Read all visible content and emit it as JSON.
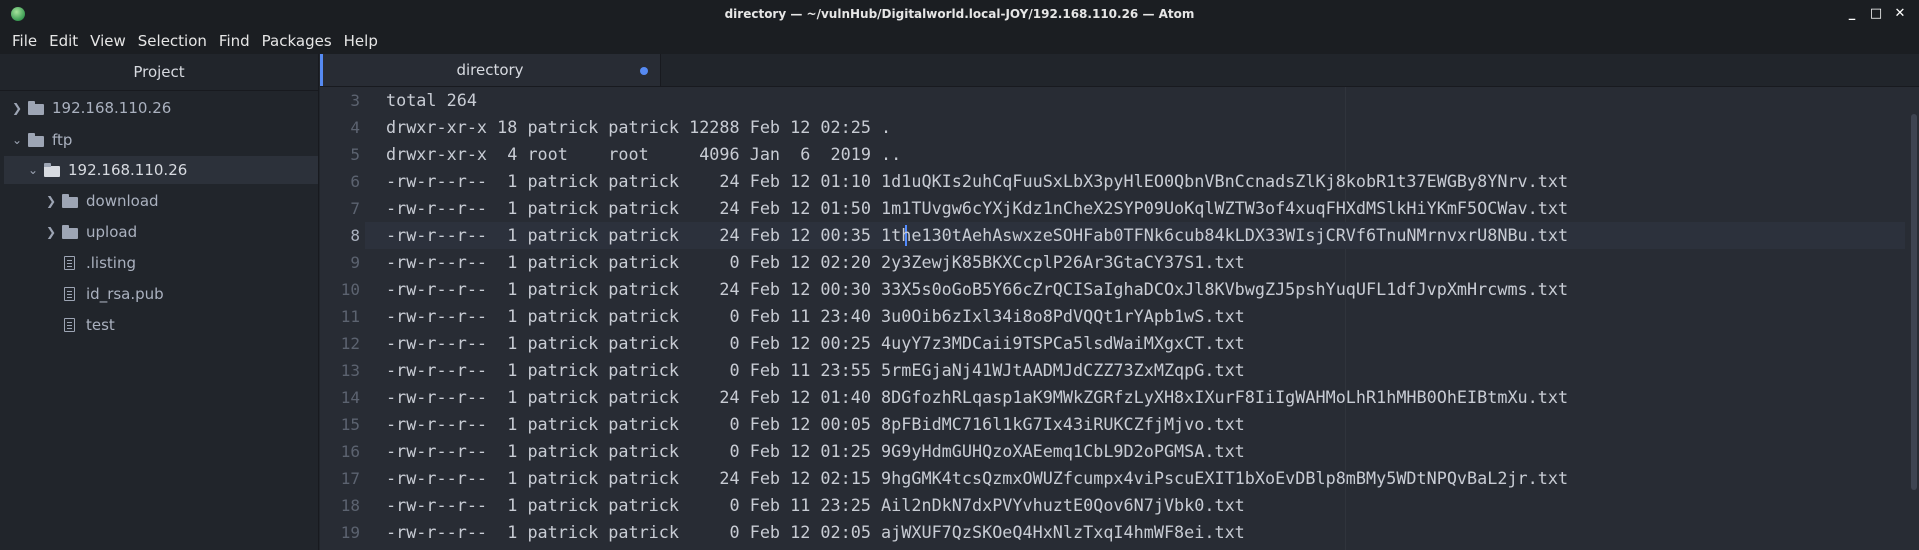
{
  "window": {
    "title": "directory — ~/vulnHub/Digitalworld.local-JOY/192.168.110.26 — Atom",
    "controls": [
      "_",
      "□",
      "✕"
    ]
  },
  "menu": [
    {
      "label": "File"
    },
    {
      "label": "Edit"
    },
    {
      "label": "View"
    },
    {
      "label": "Selection"
    },
    {
      "label": "Find"
    },
    {
      "label": "Packages"
    },
    {
      "label": "Help"
    }
  ],
  "tree": {
    "header": "Project",
    "items": [
      {
        "label": "192.168.110.26",
        "type": "folder",
        "expanded": false
      },
      {
        "label": "ftp",
        "type": "folder",
        "expanded": true
      },
      {
        "label": "192.168.110.26",
        "type": "folder",
        "expanded": true,
        "selected": true
      },
      {
        "label": "download",
        "type": "folder",
        "expanded": false
      },
      {
        "label": "upload",
        "type": "folder",
        "expanded": false
      },
      {
        "label": ".listing",
        "type": "file"
      },
      {
        "label": "id_rsa.pub",
        "type": "file"
      },
      {
        "label": "test",
        "type": "file"
      }
    ]
  },
  "editor": {
    "tab": {
      "title": "directory",
      "modified": true
    },
    "cursor_line": 8,
    "lines": [
      {
        "num": "3",
        "text": "total 264"
      },
      {
        "num": "4",
        "text": "drwxr-xr-x 18 patrick patrick 12288 Feb 12 02:25 ."
      },
      {
        "num": "5",
        "text": "drwxr-xr-x  4 root    root     4096 Jan  6  2019 .."
      },
      {
        "num": "6",
        "text": "-rw-r--r--  1 patrick patrick    24 Feb 12 01:10 1d1uQKIs2uhCqFuuSxLbX3pyHlEO0QbnVBnCcnadsZlKj8kobR1t37EWGBy8YNrv.txt"
      },
      {
        "num": "7",
        "text": "-rw-r--r--  1 patrick patrick    24 Feb 12 01:50 1m1TUvgw6cYXjKdz1nCheX2SYP09UoKqlWZTW3of4xuqFHXdMSlkHiYKmF5OCWav.txt"
      },
      {
        "num": "8",
        "text": "-rw-r--r--  1 patrick patrick    24 Feb 12 00:35 1the130tAehAswxzeSOHFab0TFNk6cub84kLDX33WIsjCRVf6TnuNMrnvxrU8NBu.txt"
      },
      {
        "num": "9",
        "text": "-rw-r--r--  1 patrick patrick     0 Feb 12 02:20 2y3ZewjK85BKXCcplP26Ar3GtaCY37S1.txt"
      },
      {
        "num": "10",
        "text": "-rw-r--r--  1 patrick patrick    24 Feb 12 00:30 33X5s0oGoB5Y66cZrQCISaIghaDCOxJl8KVbwgZJ5pshYuqUFL1dfJvpXmHrcwms.txt"
      },
      {
        "num": "11",
        "text": "-rw-r--r--  1 patrick patrick     0 Feb 11 23:40 3u0Oib6zIxl34i8o8PdVQQt1rYApb1wS.txt"
      },
      {
        "num": "12",
        "text": "-rw-r--r--  1 patrick patrick     0 Feb 12 00:25 4uyY7z3MDCaii9TSPCa5lsdWaiMXgxCT.txt"
      },
      {
        "num": "13",
        "text": "-rw-r--r--  1 patrick patrick     0 Feb 11 23:55 5rmEGjaNj41WJtAADMJdCZZ73ZxMZqpG.txt"
      },
      {
        "num": "14",
        "text": "-rw-r--r--  1 patrick patrick    24 Feb 12 01:40 8DGfozhRLqasp1aK9MWkZGRfzLyXH8xIXurF8IiIgWAHMoLhR1hMHB0OhEIBtmXu.txt"
      },
      {
        "num": "15",
        "text": "-rw-r--r--  1 patrick patrick     0 Feb 12 00:05 8pFBidMC716l1kG7Ix43iRUKCZfjMjvo.txt"
      },
      {
        "num": "16",
        "text": "-rw-r--r--  1 patrick patrick     0 Feb 12 01:25 9G9yHdmGUHQzoXAEemq1CbL9D2oPGMSA.txt"
      },
      {
        "num": "17",
        "text": "-rw-r--r--  1 patrick patrick    24 Feb 12 02:15 9hgGMK4tcsQzmxOWUZfcumpx4viPscuEXIT1bXoEvDBlp8mBMy5WDtNPQvBaL2jr.txt"
      },
      {
        "num": "18",
        "text": "-rw-r--r--  1 patrick patrick     0 Feb 11 23:25 Ail2nDkN7dxPVYvhuztE0Qov6N7jVbk0.txt"
      },
      {
        "num": "19",
        "text": "-rw-r--r--  1 patrick patrick     0 Feb 12 02:05 ajWXUF7QzSKOeQ4HxNlzTxqI4hmWF8ei.txt"
      }
    ]
  },
  "colors": {
    "accent": "#568af2",
    "background": "#282c34",
    "panel": "#21252b"
  }
}
